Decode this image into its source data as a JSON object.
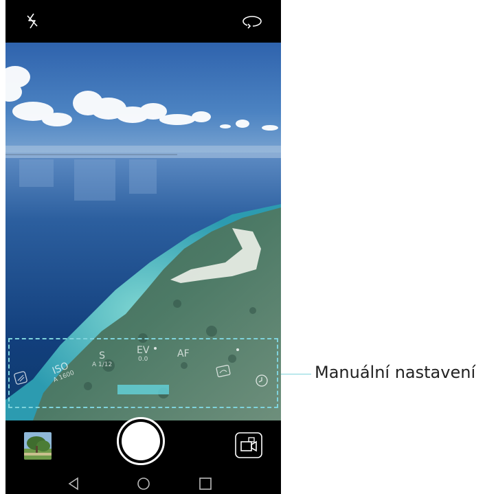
{
  "top_bar": {
    "flash_icon": "flash-off-icon",
    "switch_camera_icon": "switch-camera-icon"
  },
  "manual_controls": {
    "iso": {
      "label": "ISO",
      "value": "A 1600"
    },
    "shutter": {
      "label": "S",
      "value": "A 1/12"
    },
    "ev": {
      "label": "EV",
      "value": "0.0"
    },
    "af": {
      "label": "AF"
    },
    "wb_icon": "white-balance-icon",
    "metering_icon": "metering-icon",
    "timer_icon": "timer-icon"
  },
  "callout": {
    "label": "Manuální nastavení",
    "color": "#7fd3dc"
  },
  "bottom_bar": {
    "gallery_icon": "gallery-thumbnail",
    "shutter_icon": "shutter-button",
    "video_icon": "video-mode-icon"
  },
  "nav_bar": {
    "back_icon": "back-icon",
    "home_icon": "home-icon",
    "recents_icon": "recents-icon"
  }
}
